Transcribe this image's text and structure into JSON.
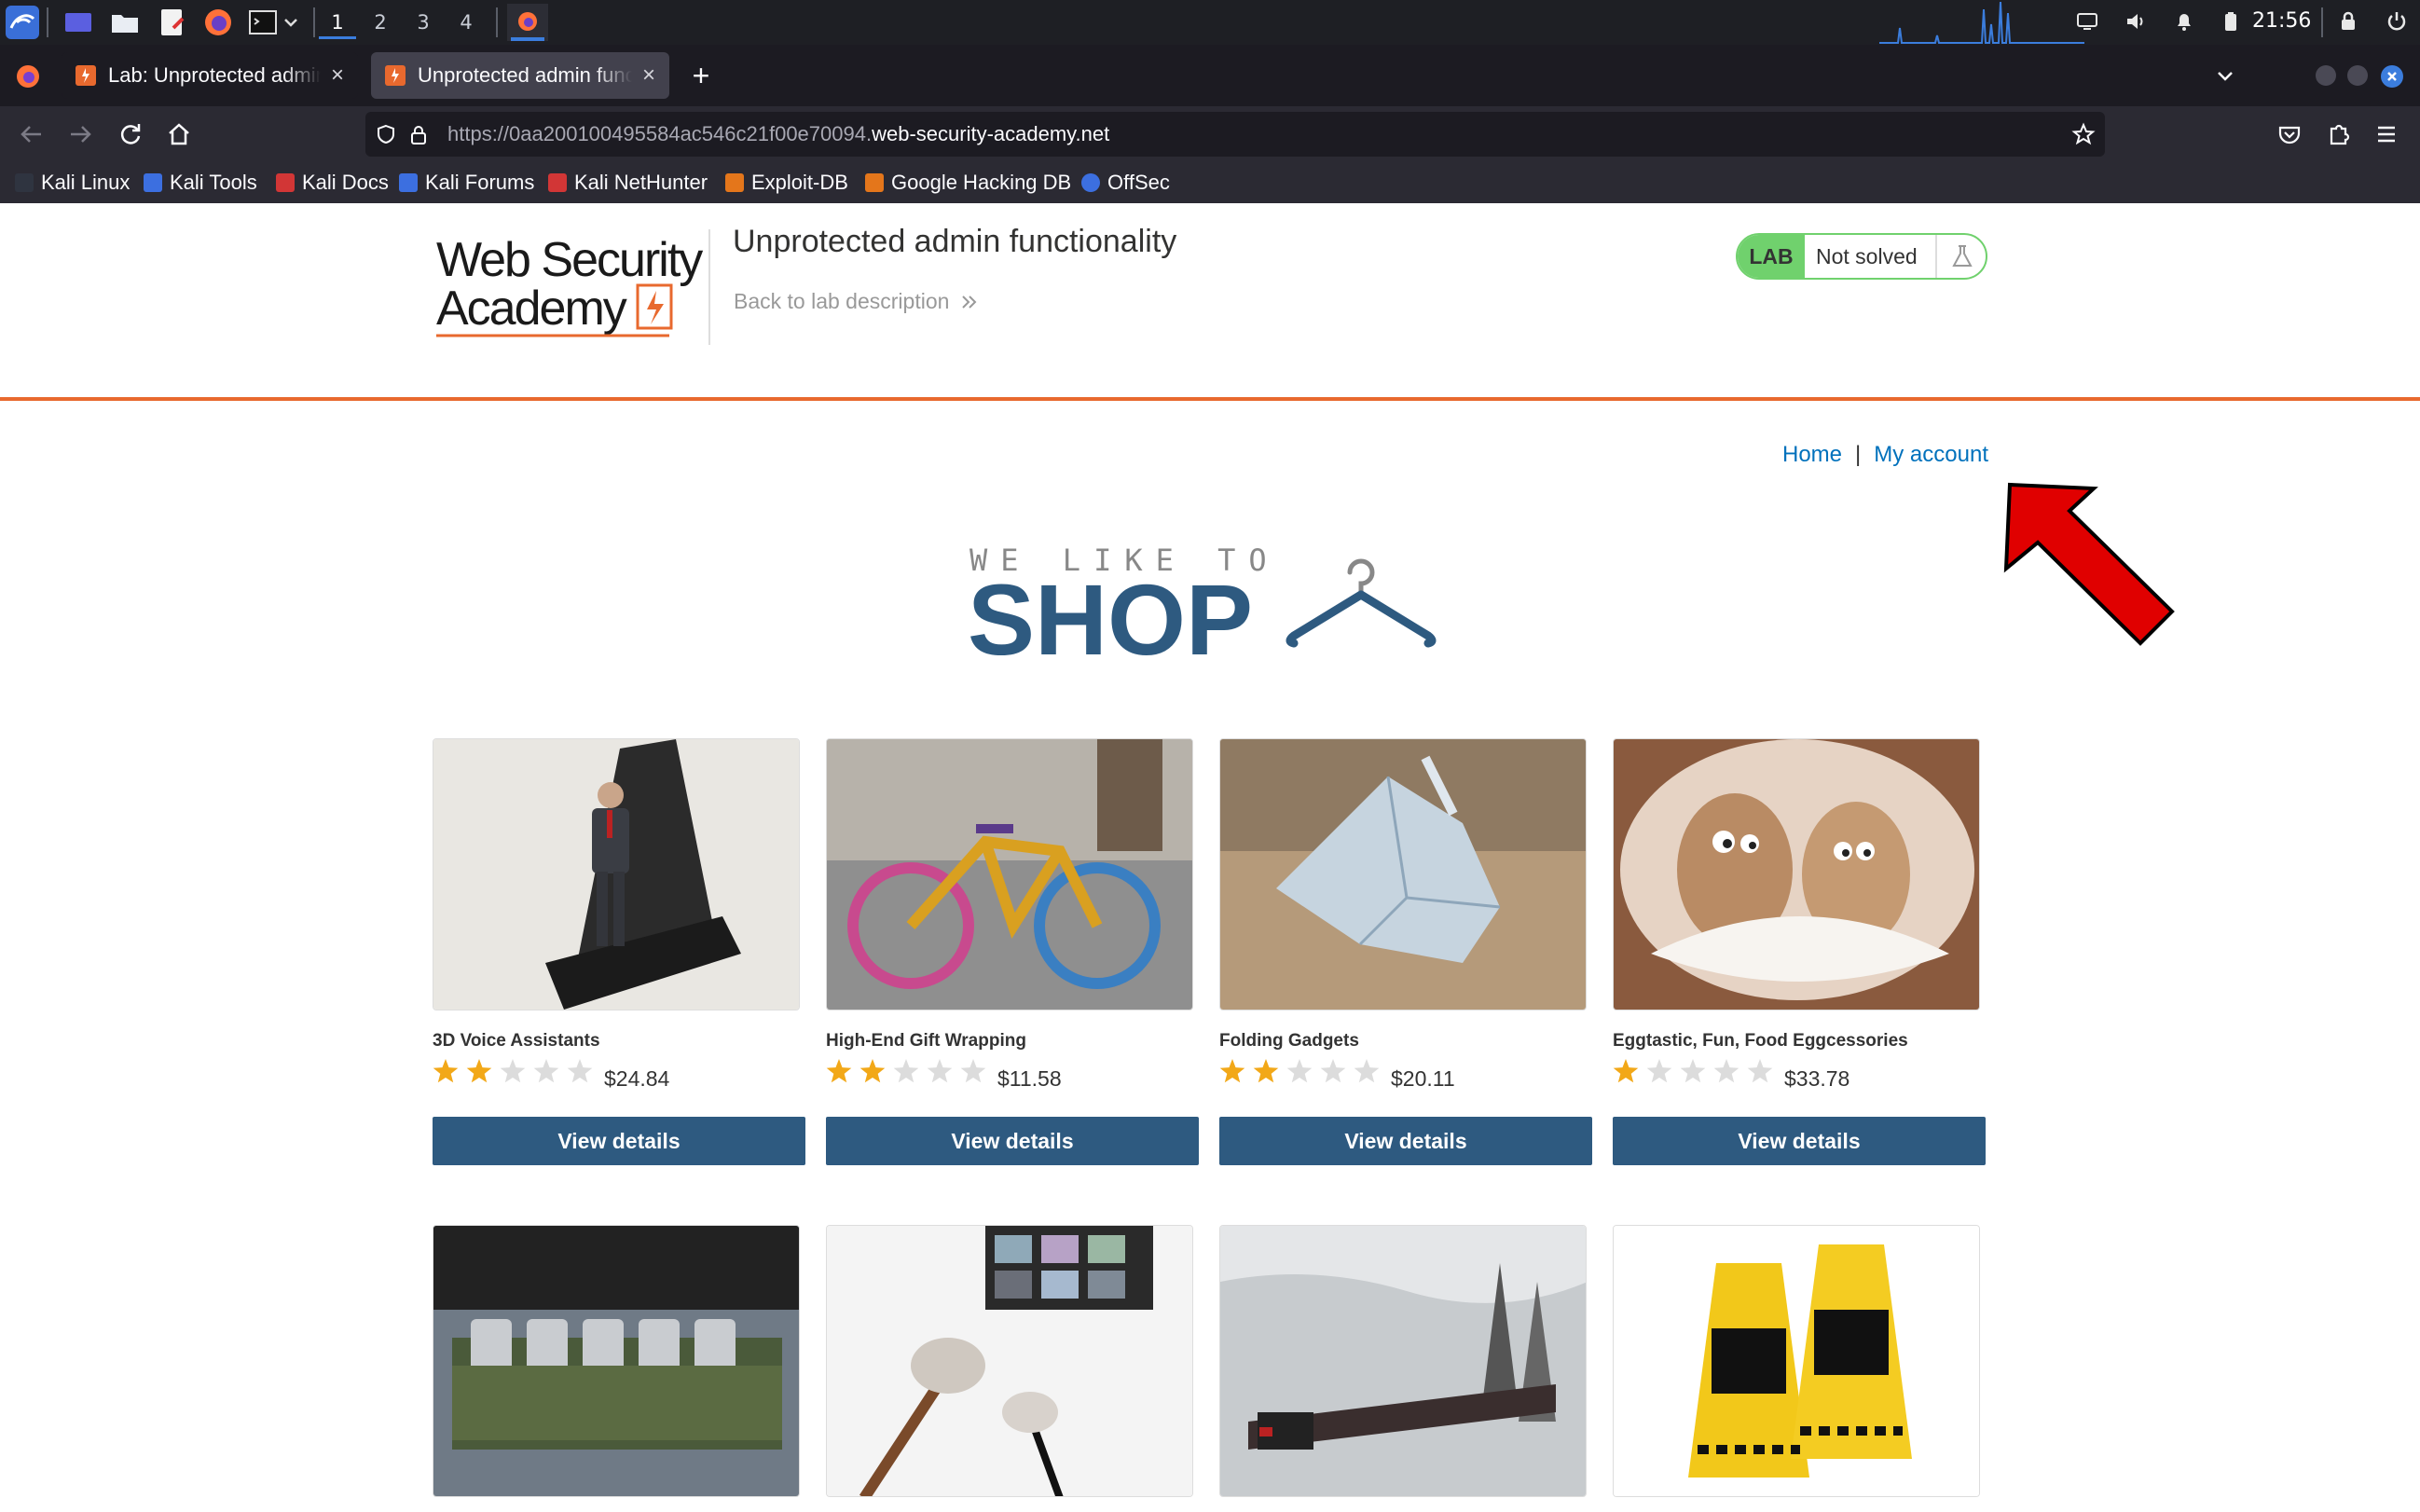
{
  "os": {
    "workspaces": [
      "1",
      "2",
      "3",
      "4"
    ],
    "clock": "21:56"
  },
  "tabs": [
    {
      "label": "Lab: Unprotected admin f",
      "active": false
    },
    {
      "label": "Unprotected admin funct",
      "active": true
    }
  ],
  "address_bar": {
    "url_prefix": "https://0aa200100495584ac546c21f00e70094.",
    "url_domain": "web-security-academy.net"
  },
  "bookmarks": [
    {
      "label": "Kali Linux",
      "icon": "kali-icon"
    },
    {
      "label": "Kali Tools",
      "icon": "kali-tools-icon"
    },
    {
      "label": "Kali Docs",
      "icon": "kali-docs-icon"
    },
    {
      "label": "Kali Forums",
      "icon": "kali-forums-icon"
    },
    {
      "label": "Kali NetHunter",
      "icon": "nethunter-icon"
    },
    {
      "label": "Exploit-DB",
      "icon": "exploit-db-icon"
    },
    {
      "label": "Google Hacking DB",
      "icon": "ghdb-icon"
    },
    {
      "label": "OffSec",
      "icon": "offsec-icon"
    }
  ],
  "lab": {
    "logo_line1": "Web Security",
    "logo_line2": "Academy",
    "title": "Unprotected admin functionality",
    "back_link": "Back to lab description",
    "badge_label": "LAB",
    "status": "Not solved"
  },
  "nav": {
    "home": "Home",
    "separator": "|",
    "account": "My account"
  },
  "banner": {
    "tagline": "WE LIKE TO",
    "word": "SHOP"
  },
  "products": [
    {
      "name": "3D Voice Assistants",
      "rating": 2,
      "price": "$24.84",
      "button": "View details"
    },
    {
      "name": "High-End Gift Wrapping",
      "rating": 2,
      "price": "$11.58",
      "button": "View details"
    },
    {
      "name": "Folding Gadgets",
      "rating": 2,
      "price": "$20.11",
      "button": "View details"
    },
    {
      "name": "Eggtastic, Fun, Food Eggcessories",
      "rating": 1,
      "price": "$33.78",
      "button": "View details"
    }
  ],
  "colors": {
    "accent_orange": "#e8692e",
    "button_blue": "#2e5a80",
    "link_blue": "#0071bc",
    "lab_green": "#70d16d",
    "star_gold": "#f2a818",
    "arrow_red": "#e00000"
  }
}
